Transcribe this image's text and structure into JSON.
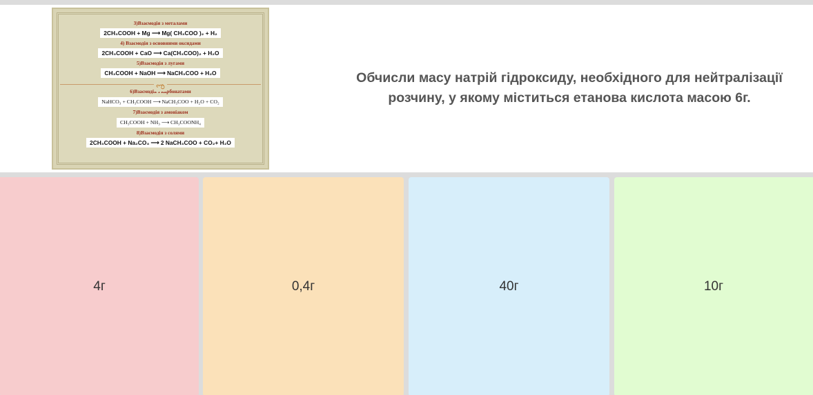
{
  "question": {
    "text": "Обчисли масу натрій гідроксиду, необхідного для нейтралізації\nрозчину, у якому міститься етанова кислота масою 6г.",
    "image": {
      "section_3_heading": "3)Взаємодія з металами",
      "section_3_equation": "2CH₃COOH + Mg ⟶ Mg( CH₃COO )₂ + H₂",
      "section_4_heading": "4) Взаємодія з основними оксидами",
      "section_4_equation": "2CH₃COOH + CaO ⟶ Ca(CH₃COO)₂ + H₂O",
      "section_5_heading": "5)Взаємодія з лугами",
      "section_5_equation": "CH₃COOH + NaOH ⟶ NaCH₃COO + H₂O",
      "ornament": "ಌ",
      "section_6_heading": "6)Взаємодія з карбонатами",
      "section_6_equation": "NaHCO₃ + CH₃COOH ⟶ NaCH₃COO + H₂O + CO₂",
      "section_7_heading": "7)Взаємодія з амоніаком",
      "section_7_equation": "CH₃COOH + NH₃ ⟶ CH₃COONH₄",
      "section_8_heading": "8)Взаємодія з солями",
      "section_8_equation": "2CH₃COOH + Na₂CO₃ ⟶ 2 NaCH₃COO + CO₂+ H₂O"
    }
  },
  "answers": [
    {
      "label": "4г",
      "color": "#f7cccd"
    },
    {
      "label": "0,4г",
      "color": "#fbe1b9"
    },
    {
      "label": "40г",
      "color": "#d7eefa"
    },
    {
      "label": "10г",
      "color": "#e1fcd1"
    }
  ]
}
